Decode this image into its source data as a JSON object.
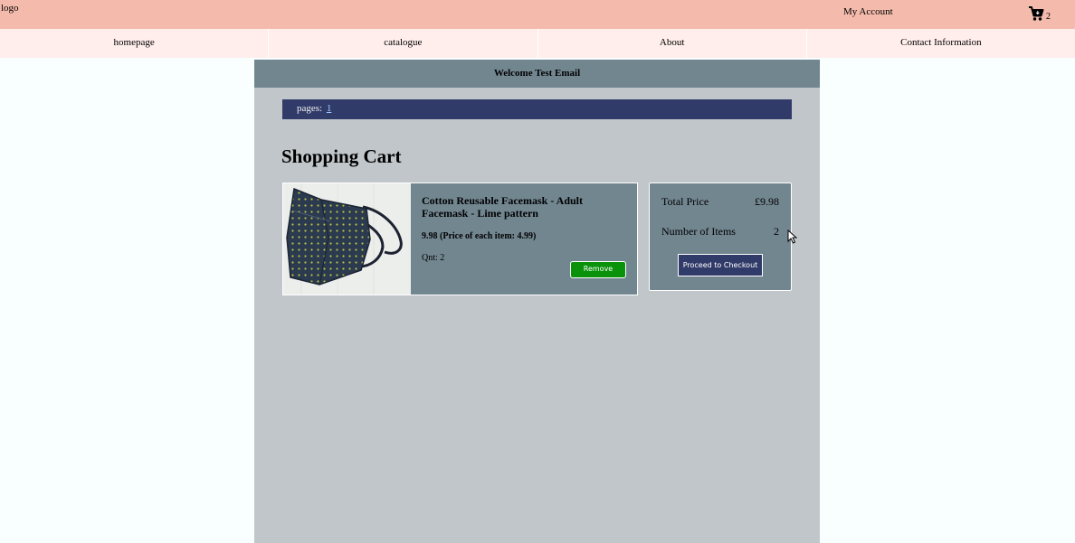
{
  "header": {
    "logo_text": "logo",
    "account_label": "My Account",
    "cart_count": "2"
  },
  "nav": {
    "items": [
      {
        "label": "homepage"
      },
      {
        "label": "catalogue"
      },
      {
        "label": "About"
      },
      {
        "label": "Contact Information"
      }
    ]
  },
  "main": {
    "welcome": "Welcome Test Email",
    "pages_label": "pages:",
    "pages": [
      "1"
    ],
    "title": "Shopping Cart"
  },
  "cart": {
    "items": [
      {
        "name": "Cotton Reusable Facemask - Adult Facemask - Lime pattern",
        "price_text": "9.98 (Price of each item: 4.99)",
        "qty_text": "Qnt: 2",
        "remove_label": "Remove"
      }
    ]
  },
  "summary": {
    "total_label": "Total Price",
    "total_value": "£9.98",
    "count_label": "Number of Items",
    "count_value": "2",
    "checkout_label": "Proceed to Checkout"
  },
  "colors": {
    "topbar": "#f4bbac",
    "navbar": "#ffeeec",
    "panel": "#c0c6c9",
    "card": "#728690",
    "pages_bar": "#313b69",
    "remove_button": "#0b920b"
  },
  "icons": {
    "cart": "cart-icon",
    "cursor": "mouse-pointer-icon"
  }
}
